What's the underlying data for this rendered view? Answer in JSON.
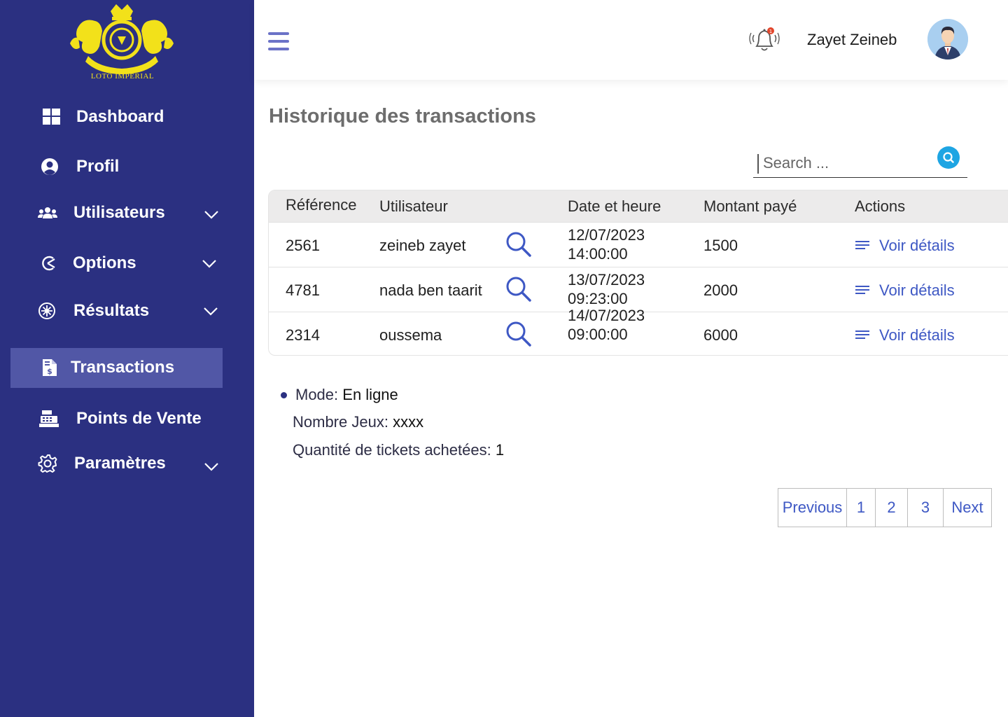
{
  "brand": {
    "logo_text": "LOTO IMPERIAL",
    "accent": "#2b3081",
    "logo_color": "#f2e11a"
  },
  "sidebar": {
    "items": [
      {
        "label": "Dashboard",
        "icon": "grid-icon",
        "has_chevron": false
      },
      {
        "label": "Profil",
        "icon": "user-circle-icon",
        "has_chevron": false
      },
      {
        "label": "Utilisateurs",
        "icon": "users-icon",
        "has_chevron": true
      },
      {
        "label": "Options",
        "icon": "options-icon",
        "has_chevron": true
      },
      {
        "label": "Résultats",
        "icon": "results-icon",
        "has_chevron": true
      },
      {
        "label": "Transactions",
        "icon": "invoice-dollar-icon",
        "has_chevron": false,
        "active": true
      },
      {
        "label": "Points de Vente",
        "icon": "cash-register-icon",
        "has_chevron": false
      },
      {
        "label": "Paramètres",
        "icon": "gear-icon",
        "has_chevron": true
      }
    ]
  },
  "header": {
    "username": "Zayet Zeineb",
    "notification_count": "1"
  },
  "main": {
    "title": "Historique des transactions",
    "search_placeholder": "Search ...",
    "table": {
      "columns": [
        "Référence",
        "Utilisateur",
        "Date et heure",
        "Montant payé",
        "Actions"
      ],
      "rows": [
        {
          "ref": "2561",
          "user": "zeineb zayet",
          "date": "12/07/2023",
          "time": "14:00:00",
          "amount": "1500",
          "action": "Voir détails"
        },
        {
          "ref": "4781",
          "user": "nada ben taarit",
          "date": "13/07/2023",
          "time": "09:23:00",
          "amount": "2000",
          "action": "Voir détails"
        },
        {
          "ref": "2314",
          "user": "oussema",
          "date": "14/07/2023",
          "time": "09:00:00",
          "amount": "6000",
          "action": "Voir détails"
        }
      ]
    },
    "details": {
      "mode_label": "Mode: ",
      "mode_value": "En ligne",
      "games_label": "Nombre Jeux: ",
      "games_value": "xxxx",
      "tickets_label": "Quantité de tickets achetées: ",
      "tickets_value": "1"
    },
    "pagination": {
      "previous": "Previous",
      "pages": [
        "1",
        "2",
        "3"
      ],
      "next": "Next"
    }
  }
}
